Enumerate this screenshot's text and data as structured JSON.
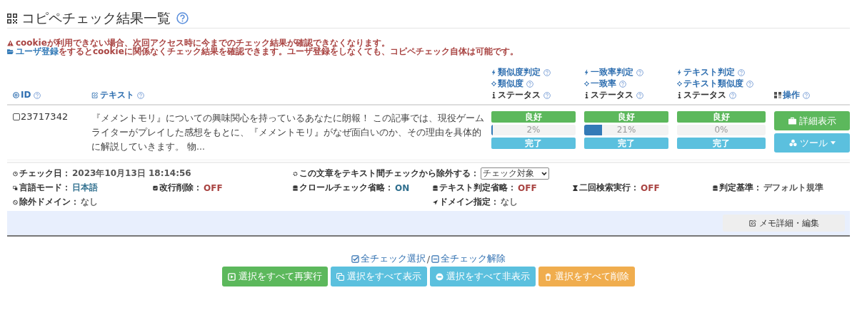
{
  "title": "コピペチェック結果一覧",
  "notices": [
    {
      "kind": "warning",
      "text": "cookieが利用できない場合、次回アクセス時に今までのチェック結果が確認できなくなります。"
    },
    {
      "kind": "info",
      "link": "ユーザ登録",
      "text": "をするとcookieに関係なくチェック結果を確認できます。ユーザ登録をしなくても、コピペチェック自体は可能です。"
    }
  ],
  "table": {
    "columns": [
      {
        "kind": "id",
        "lines": [
          "ID"
        ]
      },
      {
        "kind": "text",
        "lines": [
          "テキスト"
        ]
      },
      {
        "kind": "metric",
        "lines": [
          "類似度判定",
          "類似度",
          "ステータス"
        ]
      },
      {
        "kind": "metric",
        "lines": [
          "一致率判定",
          "一致率",
          "ステータス"
        ]
      },
      {
        "kind": "metric",
        "lines": [
          "テキスト判定",
          "テキスト類似度",
          "ステータス"
        ]
      },
      {
        "kind": "ops",
        "lines": [
          "操作"
        ]
      }
    ],
    "rows": [
      {
        "checked": false,
        "id": "23717342",
        "text": "『メメントモリ』についての興味関心を持っているあなたに朗報！ この記事では、現役ゲームライターがプレイした感想をもとに、『メメントモリ』がなぜ面白いのか、その理由を具体的に解説していきます。 物...",
        "metrics": [
          {
            "judgement": "良好",
            "level": 0.02,
            "reading": "2%",
            "status": "完了"
          },
          {
            "judgement": "良好",
            "level": 0.21,
            "reading": "21%",
            "status": "完了"
          },
          {
            "judgement": "良好",
            "level": 0,
            "reading": "0%",
            "status": "完了"
          }
        ],
        "actions": [
          {
            "kind": "detail",
            "label": "詳細表示"
          },
          {
            "kind": "tools",
            "label": "ツール"
          }
        ]
      }
    ]
  },
  "meta": {
    "rows": [
      [
        {
          "kind": "clock",
          "label": "チェック日：",
          "value": "2023年10月13日 18:14:56",
          "color": "#555555"
        },
        {
          "kind": "select",
          "label": "この文章をテキスト間チェックから除外する：",
          "value": "チェック対象"
        }
      ],
      [
        {
          "kind": "lang",
          "label": "言語モード：",
          "value": "日本語",
          "color": "#31708f"
        },
        {
          "kind": "return",
          "label": "改行削除：",
          "value": "OFF",
          "color": "#a94442"
        },
        {
          "kind": "db",
          "label": "クロールチェック省略：",
          "value": "ON",
          "color": "#31708f"
        },
        {
          "kind": "db",
          "label": "テキスト判定省略：",
          "value": "OFF",
          "color": "#a94442"
        },
        {
          "kind": "hourglass",
          "label": "二回検索実行：",
          "value": "OFF",
          "color": "#a94442"
        },
        {
          "kind": "db",
          "label": "判定基準：",
          "value": "デフォルト規準",
          "color": "#555555"
        }
      ],
      [
        {
          "kind": "ban",
          "label": "除外ドメイン：",
          "value": "なし",
          "color": "#666666"
        },
        {
          "kind": "pin",
          "label": "ドメイン指定：",
          "value": "なし",
          "color": "#666666"
        }
      ]
    ]
  },
  "memo_button": "メモ詳細・編集",
  "select_links": {
    "check_all": "全チェック選択",
    "separator": "/",
    "uncheck_all": "全チェック解除"
  },
  "bulk_buttons": [
    {
      "kind": "rerun",
      "label": "選択をすべて再実行"
    },
    {
      "kind": "show",
      "label": "選択をすべて表示"
    },
    {
      "kind": "hide",
      "label": "選択をすべて非表示"
    },
    {
      "kind": "delete",
      "label": "選択をすべて削除"
    }
  ]
}
